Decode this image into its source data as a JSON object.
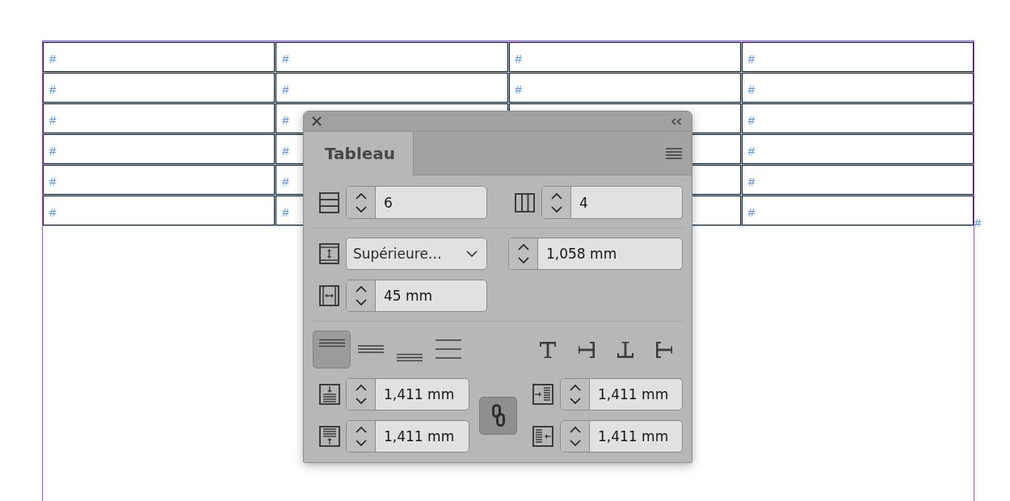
{
  "text_frame": {
    "table": {
      "rows": [
        {
          "cells": [
            "#",
            "#",
            "#",
            "#"
          ]
        },
        {
          "cells": [
            "#",
            "#",
            "#",
            "#"
          ]
        },
        {
          "cells": [
            "#",
            "#",
            null,
            "#"
          ]
        },
        {
          "cells": [
            "#",
            "#",
            null,
            "#"
          ]
        },
        {
          "cells": [
            "#",
            "#",
            null,
            "#"
          ]
        },
        {
          "cells": [
            "#",
            "#",
            null,
            "#"
          ]
        }
      ]
    },
    "end_marker": "#"
  },
  "panel": {
    "tabs": [
      {
        "label": "Tableau",
        "selected": true
      }
    ],
    "rows_count": "6",
    "columns_count": "4",
    "row_height": {
      "mode": "Supérieure…",
      "value": "1,058 mm"
    },
    "column_width": "45 mm",
    "vertical_alignment": [
      {
        "kind": "top",
        "selected": true
      },
      {
        "kind": "center",
        "selected": false
      },
      {
        "kind": "bottom",
        "selected": false
      },
      {
        "kind": "justify",
        "selected": false
      }
    ],
    "text_rotation": [
      {
        "kind": "r0",
        "selected": false
      },
      {
        "kind": "r90",
        "selected": false
      },
      {
        "kind": "r180",
        "selected": false
      },
      {
        "kind": "r270",
        "selected": false
      }
    ],
    "insets": [
      {
        "kind": "top",
        "value": "1,411 mm"
      },
      {
        "kind": "left",
        "value": "1,411 mm"
      },
      {
        "kind": "bottom",
        "value": "1,411 mm"
      },
      {
        "kind": "right",
        "value": "1,411 mm"
      }
    ],
    "link_insets": {
      "on": true
    }
  }
}
